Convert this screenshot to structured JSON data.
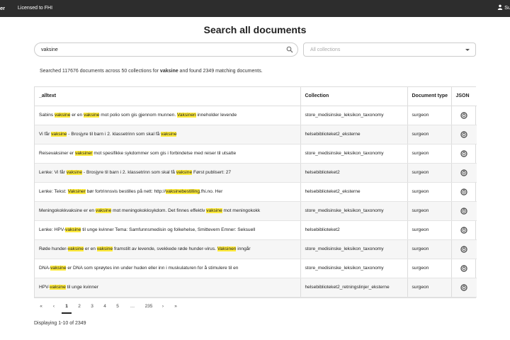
{
  "topbar": {
    "brand": "er",
    "licensed": "Licensed to FHI",
    "user_label": "Su"
  },
  "page_title": "Search all documents",
  "search": {
    "value": "vaksine"
  },
  "collection_select": {
    "placeholder": "All collections"
  },
  "summary": {
    "prefix": "Searched 117676 documents across 50 collections for ",
    "query": "vaksine",
    "suffix": " and found 2349 matching documents."
  },
  "table": {
    "columns": [
      "_alltext",
      "Collection",
      "Document type",
      "JSON"
    ],
    "rows": [
      {
        "text": [
          [
            "Sabins ",
            false
          ],
          [
            "vaksine",
            true
          ],
          [
            " er en ",
            false
          ],
          [
            "vaksine",
            true
          ],
          [
            " mot polio som gis gjennom munnen. ",
            false
          ],
          [
            "Vaksinen",
            true
          ],
          [
            " inneholder levende",
            false
          ]
        ],
        "collection": "store_medisinske_leksikon_taxonomy",
        "doctype": "surgeon"
      },
      {
        "text": [
          [
            "Vi får ",
            false
          ],
          [
            "vaksine",
            true
          ],
          [
            " - Brosjyre til barn i 2. klassetrinn som skal få ",
            false
          ],
          [
            "vaksine",
            true
          ]
        ],
        "collection": "helsebiblioteket2_eksterne",
        "doctype": "surgeon"
      },
      {
        "text": [
          [
            "Reisevaksiner er ",
            false
          ],
          [
            "vaksiner",
            true
          ],
          [
            " mot spesifikke sykdommer som gis i forbindelse med reiser til utsatte",
            false
          ]
        ],
        "collection": "store_medisinske_leksikon_taxonomy",
        "doctype": "surgeon"
      },
      {
        "text": [
          [
            "Lenke: Vi får ",
            false
          ],
          [
            "vaksine",
            true
          ],
          [
            " - Brosjyre til barn i 2. klassetrinn som skal få ",
            false
          ],
          [
            "vaksine",
            true
          ],
          [
            " Først publisert: 27",
            false
          ]
        ],
        "collection": "helsebiblioteket2",
        "doctype": "surgeon"
      },
      {
        "text": [
          [
            "Lenke: Tekst: ",
            false
          ],
          [
            "Vaksiner",
            true
          ],
          [
            " bør fortrinnsvis bestilles på nett: http://",
            false
          ],
          [
            "vaksinebestilling",
            true
          ],
          [
            ".fhi.no. Her",
            false
          ]
        ],
        "collection": "helsebiblioteket2_eksterne",
        "doctype": "surgeon"
      },
      {
        "text": [
          [
            "Meningokokkvaksine er en ",
            false
          ],
          [
            "vaksine",
            true
          ],
          [
            " mot meningokokksykdom. Det finnes effektiv ",
            false
          ],
          [
            "vaksine",
            true
          ],
          [
            " mot meningokokk",
            false
          ]
        ],
        "collection": "store_medisinske_leksikon_taxonomy",
        "doctype": "surgeon"
      },
      {
        "text": [
          [
            "Lenke: HPV-",
            false
          ],
          [
            "vaksine",
            true
          ],
          [
            " til unge kvinner Tema: Samfunnsmedisin og folkehelse, Smittevern Emner: Seksuell",
            false
          ]
        ],
        "collection": "helsebiblioteket2",
        "doctype": "surgeon"
      },
      {
        "text": [
          [
            "Røde hunder-",
            false
          ],
          [
            "vaksine",
            true
          ],
          [
            " er en ",
            false
          ],
          [
            "vaksine",
            true
          ],
          [
            " framstilt av levende, svekkede røde hunder-virus. ",
            false
          ],
          [
            "Vaksinen",
            true
          ],
          [
            " inngår",
            false
          ]
        ],
        "collection": "store_medisinske_leksikon_taxonomy",
        "doctype": "surgeon"
      },
      {
        "text": [
          [
            "DNA-",
            false
          ],
          [
            "vaksine",
            true
          ],
          [
            " er DNA som sprøytes inn under huden eller inn i muskulaturen for å stimulere til en",
            false
          ]
        ],
        "collection": "store_medisinske_leksikon_taxonomy",
        "doctype": "surgeon"
      },
      {
        "text": [
          [
            "HPV-",
            false
          ],
          [
            "vaksine",
            true
          ],
          [
            " til unge kvinner",
            false
          ]
        ],
        "collection": "helsebiblioteket2_retningslinjer_eksterne",
        "doctype": "surgeon"
      }
    ]
  },
  "pagination": {
    "items": [
      "«",
      "‹",
      "1",
      "2",
      "3",
      "4",
      "5",
      "…",
      "235",
      "›",
      "»"
    ],
    "active": "1"
  },
  "footer": "Displaying 1-10 of 2349",
  "colors": {
    "highlight": "#ffeb3b",
    "topbar": "#2d2d2d"
  }
}
